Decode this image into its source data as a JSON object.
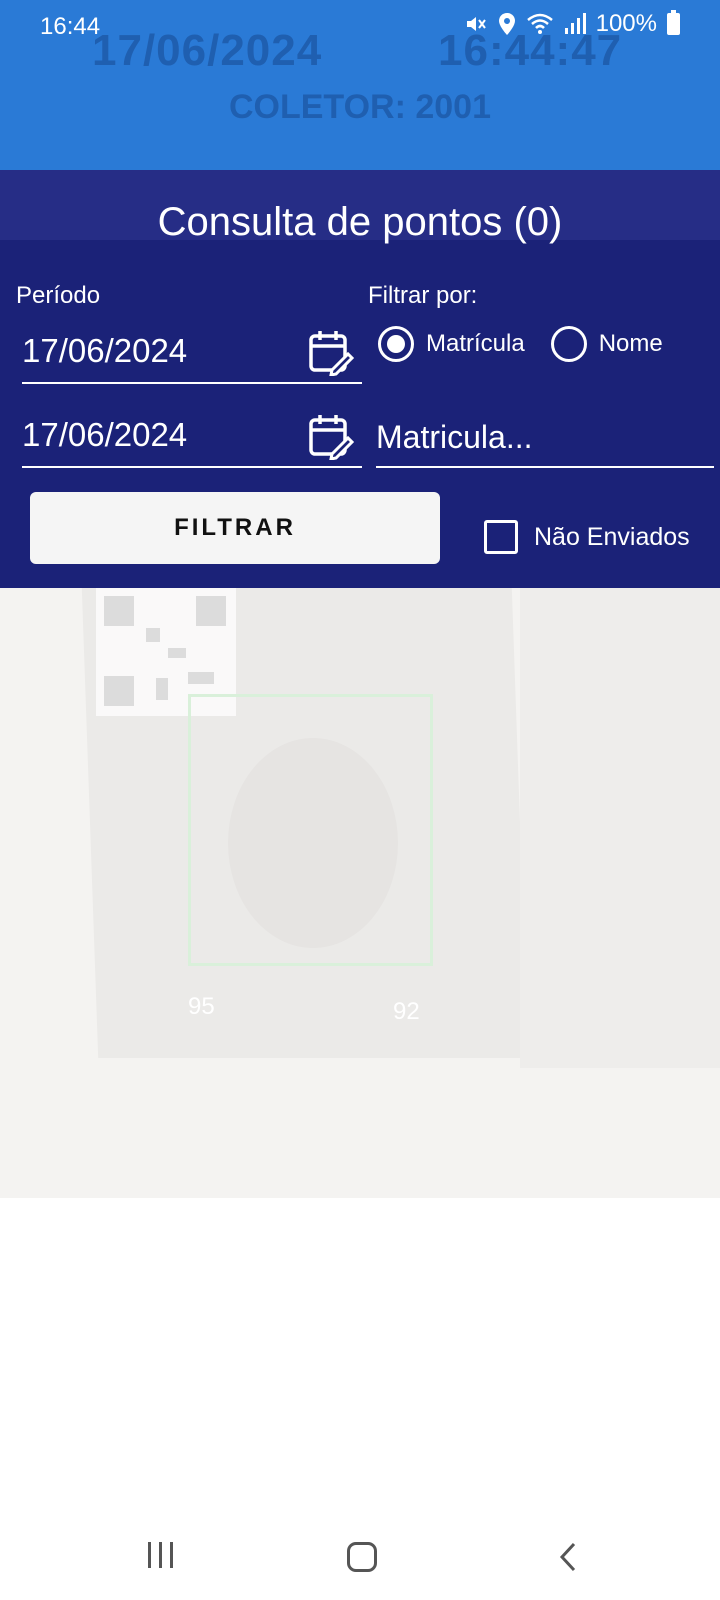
{
  "statusbar": {
    "time": "16:44",
    "battery": "100%",
    "icons": [
      "mute-icon",
      "location-icon",
      "wifi-icon",
      "signal-icon",
      "battery-icon"
    ]
  },
  "background_header": {
    "date": "17/06/2024",
    "time": "16:44:47",
    "coletor": "COLETOR: 2001"
  },
  "dialog": {
    "title": "Consulta de pontos (0)",
    "periodo_label": "Período",
    "filtrar_por_label": "Filtrar por:",
    "date_start": "17/06/2024",
    "date_end": "17/06/2024",
    "radio_options": [
      {
        "label": "Matrícula",
        "checked": true
      },
      {
        "label": "Nome",
        "checked": false
      }
    ],
    "matricula_placeholder": "Matricula...",
    "filter_button": "FILTRAR",
    "nao_enviados_label": "Não Enviados",
    "nao_enviados_checked": false
  },
  "camera": {
    "face_num_left": "95",
    "face_num_right": "92"
  },
  "colors": {
    "header_blue": "#2a7ad6",
    "dialog_navy": "#1b2278"
  }
}
